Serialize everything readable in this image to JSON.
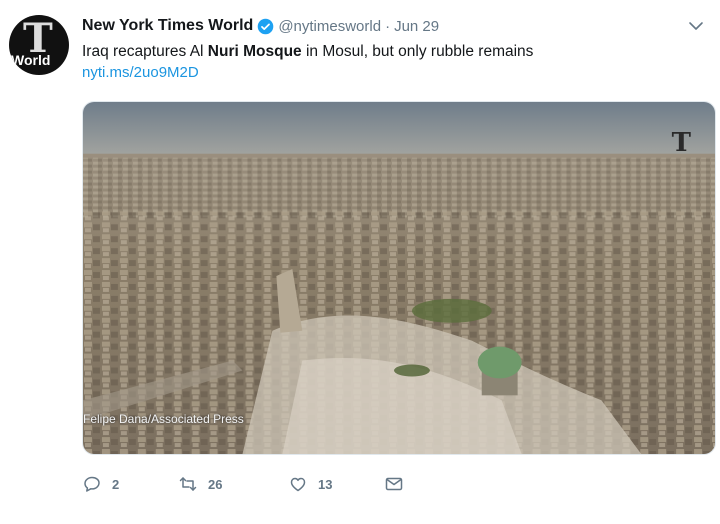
{
  "tweet": {
    "display_name": "New York Times World",
    "verified": true,
    "handle": "@nytimesworld",
    "separator": "·",
    "date": "Jun 29",
    "text_before": "Iraq recaptures Al ",
    "text_bold": "Nuri Mosque",
    "text_after": " in Mosul, but only rubble remains",
    "link": "nyti.ms/2uo9M2D",
    "avatar": {
      "glyph": "T",
      "word": "World"
    }
  },
  "media": {
    "credit": "Felipe Dana/Associated Press",
    "brand_mark": "T",
    "description_icon": "nyt-t-logo"
  },
  "actions": {
    "replies": "2",
    "retweets": "26",
    "likes": "13"
  },
  "colors": {
    "link": "#1b95e0",
    "muted": "#657786",
    "verified": "#1da1f2"
  }
}
